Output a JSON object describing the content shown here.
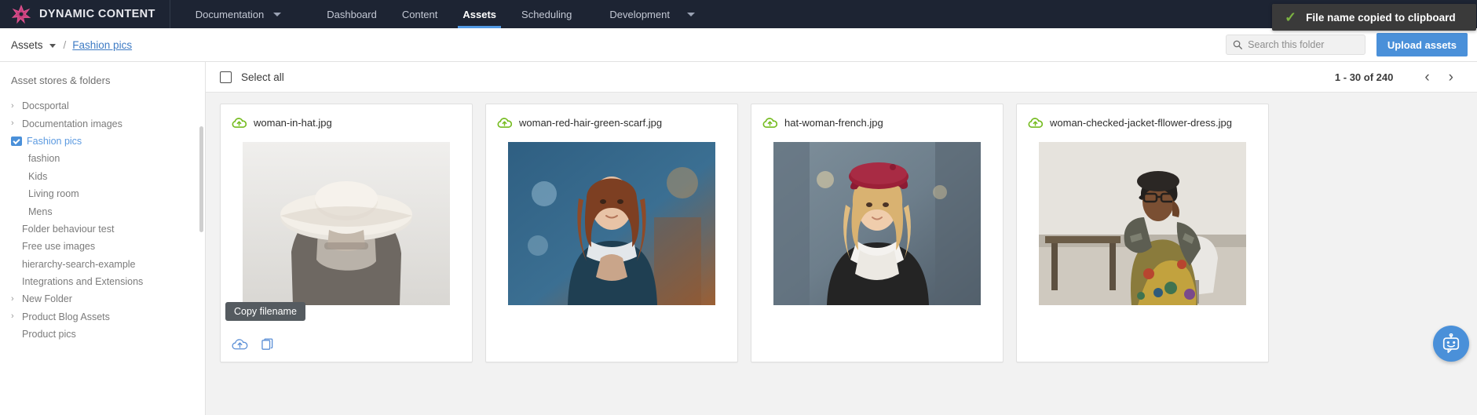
{
  "topnav": {
    "brand": "DYNAMIC CONTENT",
    "brand_icon": "star-burst-logo",
    "items": [
      {
        "label": "Documentation",
        "active": false,
        "caret": true
      },
      {
        "label": "Dashboard",
        "active": false,
        "caret": false
      },
      {
        "label": "Content",
        "active": false,
        "caret": false
      },
      {
        "label": "Assets",
        "active": true,
        "caret": false
      },
      {
        "label": "Scheduling",
        "active": false,
        "caret": false
      },
      {
        "label": "Development",
        "active": false,
        "caret": true
      }
    ]
  },
  "toast": {
    "message": "File name copied to clipboard",
    "icon": "check-icon",
    "icon_glyph": "✓",
    "bg_color": "#3a3a3a",
    "icon_color": "#7cb342"
  },
  "breadcrumb": {
    "root": "Assets",
    "separator": "/",
    "current": "Fashion pics"
  },
  "search": {
    "placeholder": "Search this folder",
    "value": "",
    "icon": "search-icon"
  },
  "upload_button": {
    "label": "Upload assets",
    "color": "#4a90d9"
  },
  "sidebar": {
    "title": "Asset stores & folders",
    "items": [
      {
        "label": "Docsportal",
        "chevron": "›",
        "indent": 0,
        "selected": false,
        "folder_icon": false
      },
      {
        "label": "Documentation images",
        "chevron": "›",
        "indent": 0,
        "selected": false,
        "folder_icon": false
      },
      {
        "label": "Fashion pics",
        "chevron": "",
        "indent": 0,
        "selected": true,
        "folder_icon": true
      },
      {
        "label": "fashion",
        "chevron": "",
        "indent": 1,
        "selected": false,
        "folder_icon": false
      },
      {
        "label": "Kids",
        "chevron": "",
        "indent": 1,
        "selected": false,
        "folder_icon": false
      },
      {
        "label": "Living room",
        "chevron": "",
        "indent": 1,
        "selected": false,
        "folder_icon": false
      },
      {
        "label": "Mens",
        "chevron": "",
        "indent": 1,
        "selected": false,
        "folder_icon": false
      },
      {
        "label": "Folder behaviour test",
        "chevron": "",
        "indent": 0,
        "selected": false,
        "folder_icon": false
      },
      {
        "label": "Free use images",
        "chevron": "",
        "indent": 0,
        "selected": false,
        "folder_icon": false
      },
      {
        "label": "hierarchy-search-example",
        "chevron": "",
        "indent": 0,
        "selected": false,
        "folder_icon": false
      },
      {
        "label": "Integrations and Extensions",
        "chevron": "",
        "indent": 0,
        "selected": false,
        "folder_icon": false
      },
      {
        "label": "New Folder",
        "chevron": "›",
        "indent": 0,
        "selected": false,
        "folder_icon": false
      },
      {
        "label": "Product Blog Assets",
        "chevron": "›",
        "indent": 0,
        "selected": false,
        "folder_icon": false
      },
      {
        "label": "Product pics",
        "chevron": "",
        "indent": 0,
        "selected": false,
        "folder_icon": false
      }
    ]
  },
  "main": {
    "select_all_label": "Select all",
    "select_all_checked": false,
    "page_count": "1 - 30 of 240",
    "prev_glyph": "‹",
    "next_glyph": "›",
    "tooltip": "Copy filename",
    "cards": [
      {
        "filename": "woman-in-hat.jpg",
        "status_icon": "cloud-upload-icon",
        "thumb": "woman-in-hat-bw"
      },
      {
        "filename": "woman-red-hair-green-scarf.jpg",
        "status_icon": "cloud-upload-icon",
        "thumb": "woman-red-hair"
      },
      {
        "filename": "hat-woman-french.jpg",
        "status_icon": "cloud-upload-icon",
        "thumb": "hat-woman-french"
      },
      {
        "filename": "woman-checked-jacket-fllower-dress.jpg",
        "status_icon": "cloud-upload-icon",
        "thumb": "woman-checked-jacket"
      }
    ],
    "card_actions": [
      {
        "name": "publish-icon"
      },
      {
        "name": "copy-filename-icon"
      }
    ]
  },
  "chat_button": {
    "icon": "chatbot-icon",
    "color": "#4a90d9"
  }
}
